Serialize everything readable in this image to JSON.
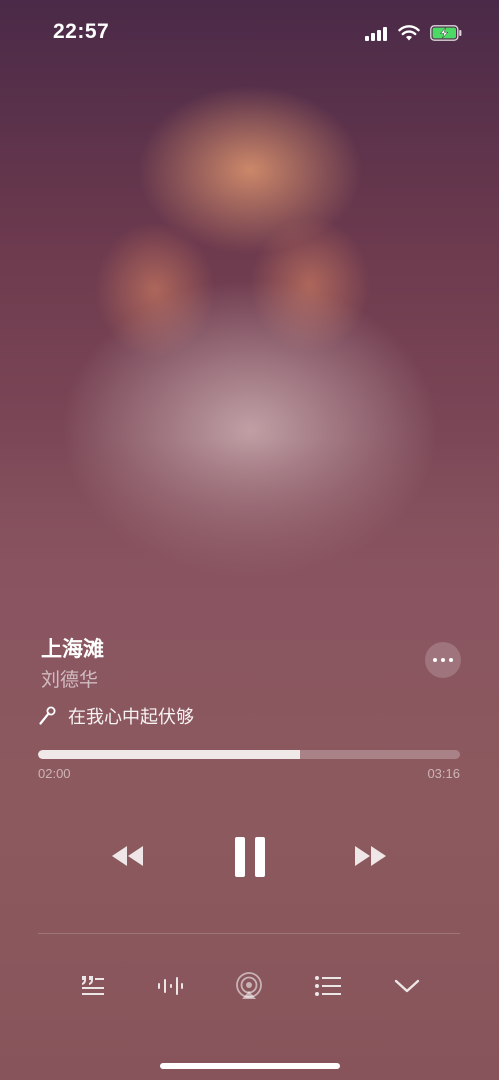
{
  "status_bar": {
    "time": "22:57"
  },
  "now_playing": {
    "title": "上海滩",
    "artist": "刘德华",
    "lyric": "在我心中起伏够",
    "elapsed": "02:00",
    "duration": "03:16",
    "progress": 0.62
  },
  "icons": {
    "more": "ellipsis-icon",
    "lyric": "microphone-icon",
    "rewind": "rewind-icon",
    "pause": "pause-icon",
    "forward": "fast-forward-icon",
    "lyrics_toggle": "lyrics-icon",
    "visualizer": "waveform-icon",
    "airplay": "airplay-icon",
    "queue": "list-icon",
    "collapse": "chevron-down-icon"
  },
  "colors": {
    "accent": "#ffffff",
    "battery_charge": "#4cd964"
  }
}
